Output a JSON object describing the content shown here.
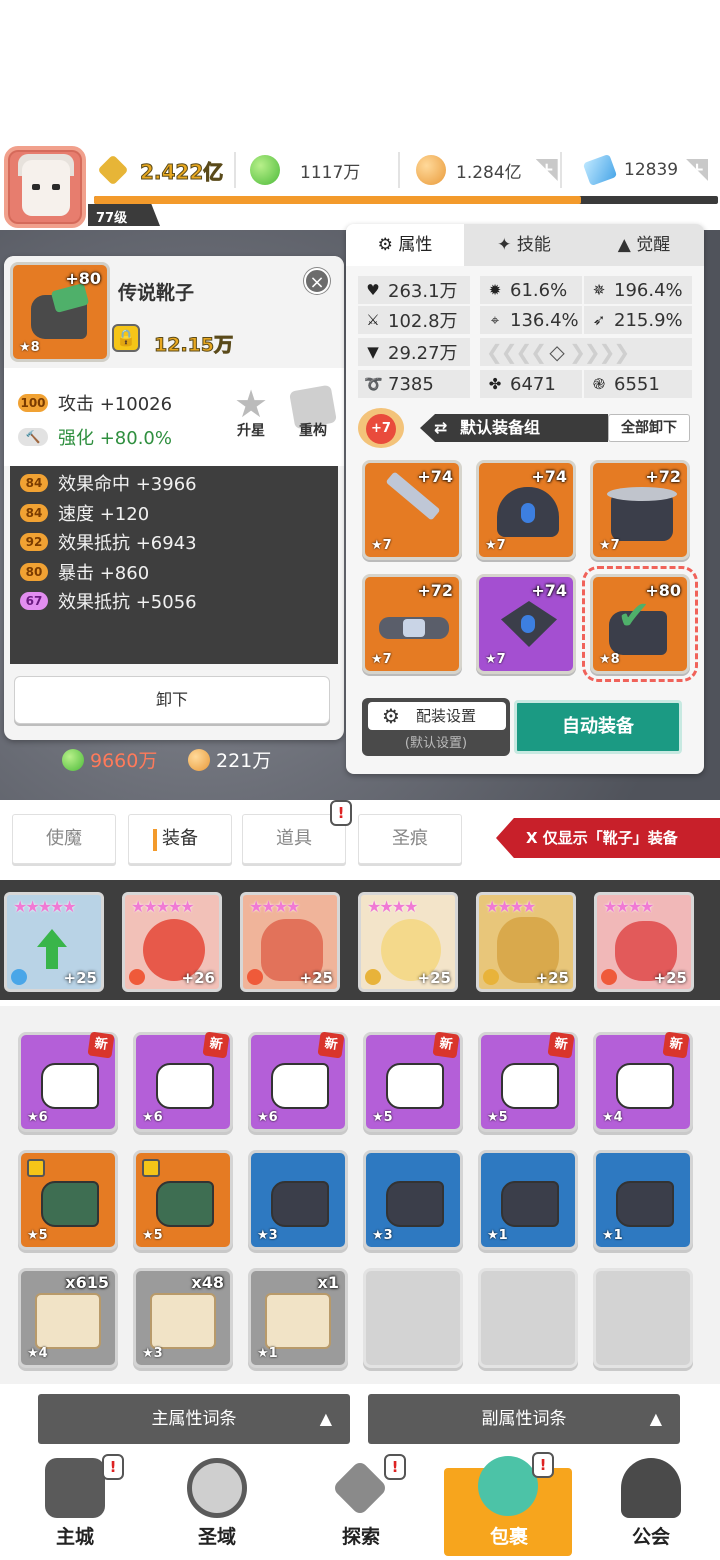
{
  "player": {
    "level": "77级",
    "xp_fraction": 0.78
  },
  "currencies": {
    "power": "2.422亿",
    "green_gem": "1117万",
    "gold": "1.284亿",
    "diamond": "12839",
    "plus": "+"
  },
  "detail": {
    "item_name": "传说靴子",
    "item_plus": "+80",
    "item_star": "★8",
    "power": "12.15万",
    "close": "×",
    "main_stat_level": "100",
    "main_stat": "攻击 +10026",
    "enhance": "强化 +80.0%",
    "upgrade_star": "升星",
    "rebuild": "重构",
    "substats": [
      {
        "lv": "84",
        "text": "效果命中 +3966",
        "color": "#f1a233"
      },
      {
        "lv": "84",
        "text": "速度 +120",
        "color": "#f1a233"
      },
      {
        "lv": "92",
        "text": "效果抵抗 +6943",
        "color": "#f1a233"
      },
      {
        "lv": "80",
        "text": "暴击 +860",
        "color": "#f1a233"
      },
      {
        "lv": "67",
        "text": "效果抵抗 +5056",
        "color": "#e28ef0"
      }
    ],
    "unequip": "卸下"
  },
  "resources": {
    "green": "9660万",
    "gold": "221万"
  },
  "hero_panel": {
    "tabs": [
      "属性",
      "技能",
      "觉醒"
    ],
    "stats": {
      "hp": "263.1万",
      "crit_rate": "61.6%",
      "crit_dmg": "196.4%",
      "atk": "102.8万",
      "accuracy": "136.4%",
      "speed_pct": "215.9%",
      "def": "29.27万",
      "spd": "7385",
      "resist1": "6471",
      "resist2": "6551"
    },
    "set_level": "+7",
    "set_name": "默认装备组",
    "unequip_all": "全部卸下",
    "equipment": [
      {
        "plus": "+74",
        "star": "★7",
        "rarity": "orange"
      },
      {
        "plus": "+74",
        "star": "★7",
        "rarity": "orange"
      },
      {
        "plus": "+72",
        "star": "★7",
        "rarity": "orange"
      },
      {
        "plus": "+72",
        "star": "★7",
        "rarity": "orange"
      },
      {
        "plus": "+74",
        "star": "★7",
        "rarity": "purple"
      },
      {
        "plus": "+80",
        "star": "★8",
        "rarity": "orange"
      }
    ],
    "config": "配装设置",
    "config_sub": "(默认设置)",
    "auto_equip": "自动装备"
  },
  "categories": [
    "使魔",
    "装备",
    "道具",
    "圣痕"
  ],
  "filter_banner": "X  仅显示「靴子」装备",
  "heroes": [
    {
      "stars": "★★★★★",
      "lv": "+25",
      "bg": "#b9d3e6",
      "elem": "#4aa6e8"
    },
    {
      "stars": "★★★★★",
      "lv": "+26",
      "bg": "#f2c1b8",
      "elem": "#ef5a3a"
    },
    {
      "stars": "★★★★",
      "lv": "+25",
      "bg": "#f0b49a",
      "elem": "#ef5a3a"
    },
    {
      "stars": "★★★★",
      "lv": "+25",
      "bg": "#f3e4c9",
      "elem": "#e8b33a"
    },
    {
      "stars": "★★★★",
      "lv": "+25",
      "bg": "#e8c67a",
      "elem": "#e8b33a"
    },
    {
      "stars": "★★★★",
      "lv": "+25",
      "bg": "#f1b8b8",
      "elem": "#ef5a3a"
    }
  ],
  "inventory": [
    {
      "rarity": "purple",
      "star": "★6",
      "new": "新"
    },
    {
      "rarity": "purple",
      "star": "★6",
      "new": "新"
    },
    {
      "rarity": "purple",
      "star": "★6",
      "new": "新"
    },
    {
      "rarity": "purple",
      "star": "★5",
      "new": "新"
    },
    {
      "rarity": "purple",
      "star": "★5",
      "new": "新"
    },
    {
      "rarity": "purple",
      "star": "★4",
      "new": "新"
    },
    {
      "rarity": "orange",
      "star": "★5",
      "locked": true
    },
    {
      "rarity": "orange",
      "star": "★5",
      "locked": true
    },
    {
      "rarity": "blue",
      "star": "★3"
    },
    {
      "rarity": "blue",
      "star": "★3"
    },
    {
      "rarity": "blue",
      "star": "★1"
    },
    {
      "rarity": "blue",
      "star": "★1"
    },
    {
      "rarity": "scroll",
      "star": "★4",
      "qty": "x615"
    },
    {
      "rarity": "scroll",
      "star": "★3",
      "qty": "x48"
    },
    {
      "rarity": "scroll",
      "star": "★1",
      "qty": "x1"
    },
    {
      "rarity": "empty"
    },
    {
      "rarity": "empty"
    },
    {
      "rarity": "empty"
    }
  ],
  "sort": {
    "main": "主属性词条",
    "sub": "副属性词条",
    "arrow": "▲"
  },
  "nav": [
    "主城",
    "圣域",
    "探索",
    "包裹",
    "公会"
  ],
  "alert": "!"
}
